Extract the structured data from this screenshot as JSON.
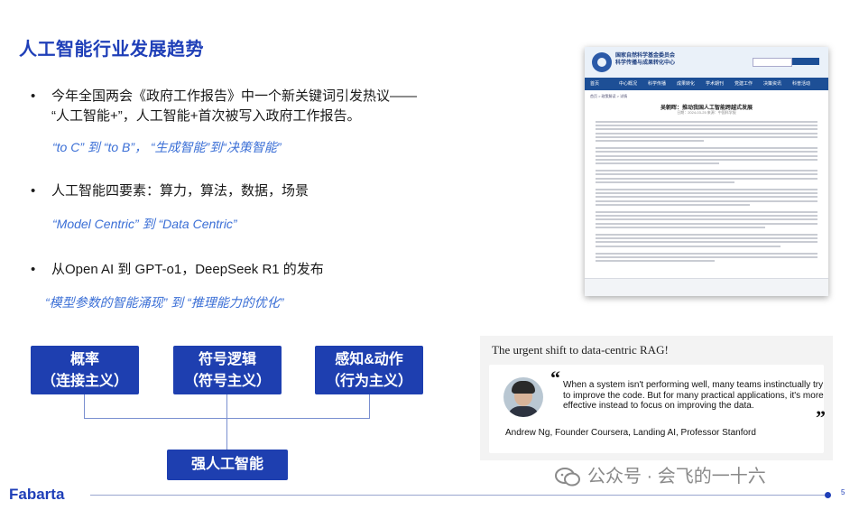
{
  "slide": {
    "title": "人工智能行业发展趋势",
    "page_number": "5",
    "watermark": "公众号 · 会飞的一十六",
    "logo": "Fabarta"
  },
  "bullets": [
    {
      "line1": "今年全国两会《政府工作报告》中一个新关键词引发热议——",
      "line2": "“人工智能+”，人工智能+首次被写入政府工作报告。",
      "sub": "“to C”  到  “to B”，  “生成智能”到“决策智能”"
    },
    {
      "line1": "人工智能四要素：算力，算法，数据，场景",
      "sub": "“Model Centric”  到  “Data Centric”"
    },
    {
      "line1": "从Open AI 到 GPT-o1，DeepSeek R1 的发布",
      "sub": "“模型参数的智能涌现”  到  “推理能力的优化”"
    }
  ],
  "diagram": {
    "boxes": [
      {
        "l1": "概率",
        "l2": "（连接主义）"
      },
      {
        "l1": "符号逻辑",
        "l2": "（符号主义）"
      },
      {
        "l1": "感知&动作",
        "l2": "（行为主义）"
      }
    ],
    "target": "强人工智能"
  },
  "quote_card": {
    "heading": "The urgent shift to data-centric RAG!",
    "quote": "When a system isn't performing well, many teams instinctually try to improve the code. But for many practical applications, it's more effective instead to focus on improving the data.",
    "author": "Andrew Ng, Founder Coursera, Landing AI, Professor Stanford"
  },
  "doc_screenshot": {
    "org_line1": "国家自然科学基金委员会",
    "org_line2": "科学传播与成果转化中心",
    "nav": [
      "首页",
      "中心概况",
      "科学传播",
      "成果转化",
      "学术期刊",
      "党建工作",
      "决策资讯",
      "科普活动"
    ],
    "breadcrumb": "首页 > 政策解读 > 详情",
    "title": "吴朝晖：推动我国人工智能跨越式发展",
    "meta": "日期：2024-03-25    来源：中国科学报"
  },
  "colors": {
    "brand": "#1f3fb8",
    "box": "#1e3fb0",
    "accent_text": "#3b6fd6"
  },
  "icons": [
    "wechat-icon",
    "quote-open-icon",
    "quote-close-icon"
  ]
}
